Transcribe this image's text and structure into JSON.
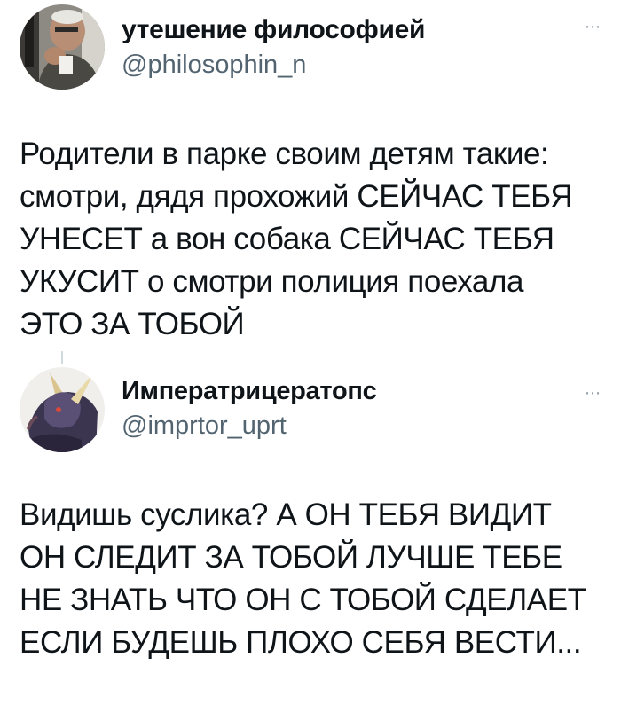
{
  "tweets": [
    {
      "display_name": "утешение философией",
      "handle": "@philosophin_n",
      "more_icon": "⋯",
      "text": "Родители в парке своим детям такие:\nсмотри, дядя прохожий СЕЙЧАС ТЕБЯ\nУНЕСЕТ а вон собака СЕЙЧАС ТЕБЯ\nУКУСИТ о смотри полиция поехала\nЭТО ЗА ТОБОЙ"
    },
    {
      "display_name": "Императрицератопс",
      "handle": "@imprtor_uprt",
      "more_icon": "⋯",
      "text": "Видишь суслика? А ОН ТЕБЯ ВИДИТ\nОН СЛЕДИТ ЗА ТОБОЙ ЛУЧШЕ ТЕБЕ\nНЕ ЗНАТЬ ЧТО ОН С ТОБОЙ СДЕЛАЕТ\nЕСЛИ БУДЕШЬ ПЛОХО СЕБЯ ВЕСТИ..."
    }
  ]
}
